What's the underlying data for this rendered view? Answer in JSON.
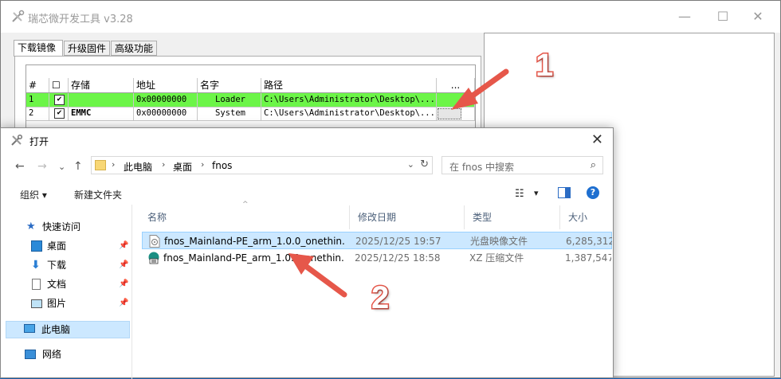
{
  "app": {
    "title": "瑞芯微开发工具 v3.28",
    "window_buttons": {
      "minimize": "—",
      "maximize": "☐",
      "close": "✕"
    },
    "tabs": [
      {
        "label": "下载镜像",
        "active": true
      },
      {
        "label": "升级固件",
        "active": false
      },
      {
        "label": "高级功能",
        "active": false
      }
    ],
    "grid": {
      "headers": [
        "#",
        "☐",
        "存储",
        "地址",
        "名字",
        "路径",
        "..."
      ],
      "rows": [
        {
          "num": "1",
          "checked": true,
          "storage": "",
          "address": "0x00000000",
          "name": "Loader",
          "path": "C:\\Users\\Administrator\\Desktop\\...",
          "selected": true
        },
        {
          "num": "2",
          "checked": true,
          "storage": "EMMC",
          "address": "0x00000000",
          "name": "System",
          "path": "C:\\Users\\Administrator\\Desktop\\...",
          "selected": false
        }
      ]
    }
  },
  "dialog": {
    "title": "打开",
    "close": "✕",
    "nav": {
      "back": "←",
      "forward": "→",
      "dropdown": "⌄",
      "up": "↑"
    },
    "address": {
      "crumbs": [
        "此电脑",
        "桌面",
        "fnos"
      ],
      "sep": "›",
      "dropdown": "⌄",
      "refresh": "↻"
    },
    "search_placeholder": "在 fnos 中搜索",
    "toolbar": {
      "organize": "组织 ▾",
      "new_folder": "新建文件夹",
      "view": "▾",
      "help": "?"
    },
    "nav_pane": [
      {
        "label": "快速访问",
        "icon": "star-icon"
      },
      {
        "label": "桌面",
        "icon": "desktop-icon",
        "pinned": true
      },
      {
        "label": "下载",
        "icon": "download-icon",
        "pinned": true
      },
      {
        "label": "文档",
        "icon": "document-icon",
        "pinned": true
      },
      {
        "label": "图片",
        "icon": "picture-icon",
        "pinned": true
      },
      {
        "label": "此电脑",
        "icon": "computer-icon",
        "selected": true
      },
      {
        "label": "网络",
        "icon": "network-icon"
      }
    ],
    "columns": [
      "名称",
      "修改日期",
      "类型",
      "大小"
    ],
    "sort_caret": "^",
    "files": [
      {
        "name": "fnos_Mainland-PE_arm_1.0.0_onethin...",
        "date": "2025/12/25 19:57",
        "type": "光盘映像文件",
        "size": "6,285,312",
        "icon": "disc-image-icon",
        "selected": true
      },
      {
        "name": "fnos_Mainland-PE_arm_1.0.0_onethin...",
        "date": "2025/12/25 18:58",
        "type": "XZ 压缩文件",
        "size": "1,387,547",
        "icon": "archive-icon",
        "selected": false
      }
    ]
  },
  "annotations": {
    "step1": "1",
    "step2": "2",
    "color": "#e6574a"
  }
}
